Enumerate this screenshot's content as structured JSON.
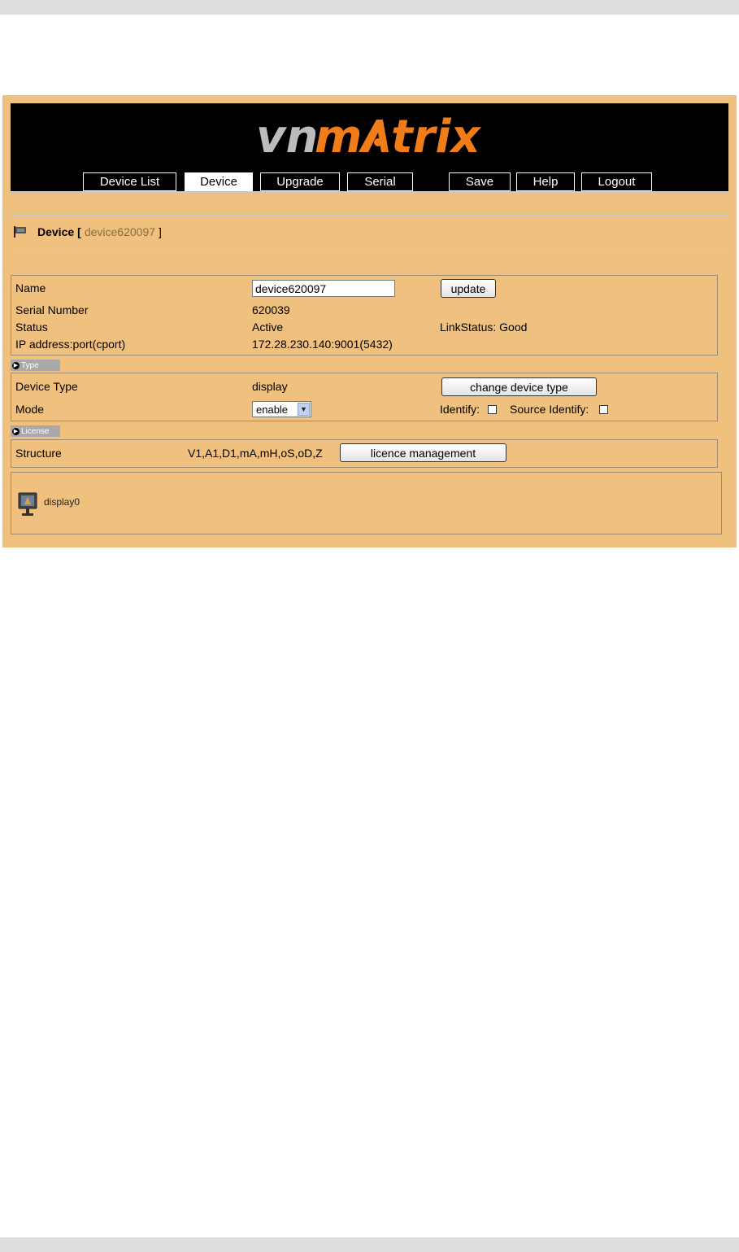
{
  "header": {
    "logo": {
      "part1": "vn",
      "part2": "m",
      "part3": "trix"
    },
    "nav": [
      {
        "label": "Device List"
      },
      {
        "label": "Device",
        "active": true
      },
      {
        "label": "Upgrade"
      },
      {
        "label": "Serial"
      },
      {
        "label": "Save"
      },
      {
        "label": "Help"
      },
      {
        "label": "Logout"
      }
    ]
  },
  "page": {
    "title": "Device",
    "bracket_open": "[",
    "device_name": "device620097",
    "bracket_close": "]"
  },
  "info": {
    "name_label": "Name",
    "name_value": "device620097",
    "update_button": "update",
    "serial_label": "Serial Number",
    "serial_value": "620039",
    "status_label": "Status",
    "status_value": "Active",
    "link_status": "LinkStatus: Good",
    "ip_label": "IP address:port(cport)",
    "ip_value": "172.28.230.140:9001(5432)"
  },
  "type_section": {
    "tab_label": "Type",
    "device_type_label": "Device Type",
    "device_type_value": "display",
    "change_button": "change device type",
    "mode_label": "Mode",
    "mode_value": "enable",
    "identify_label": "Identify:",
    "source_identify_label": "Source Identify:"
  },
  "license_section": {
    "tab_label": "License",
    "structure_label": "Structure",
    "structure_value": "V1,A1,D1,mA,mH,oS,oD,Z",
    "licence_button": "licence management"
  },
  "devices": [
    {
      "label": "display0",
      "icon": "monitor-icon"
    }
  ],
  "colors": {
    "panel_bg": "#efc07e",
    "header_bg": "#000000",
    "logo_gray": "#bcbcbc",
    "logo_orange": "#f07d1a"
  }
}
